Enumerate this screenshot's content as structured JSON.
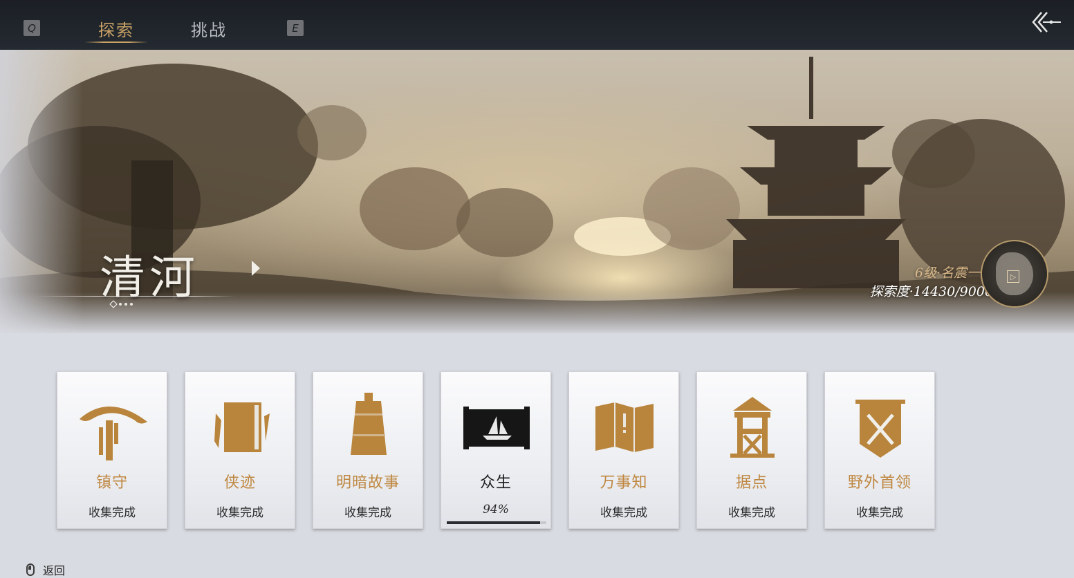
{
  "topbar": {
    "key_left": "Q",
    "key_right": "E",
    "tabs": [
      {
        "label": "探索",
        "active": true
      },
      {
        "label": "挑战",
        "active": false
      }
    ]
  },
  "region": {
    "name": "清河",
    "level_text": "6级·名震一方",
    "explore_text": "探索度·14430/9000"
  },
  "cards": [
    {
      "title": "镇守",
      "status": "收集完成",
      "icon": "straw-hat-icon"
    },
    {
      "title": "侠迹",
      "status": "收集完成",
      "icon": "book-icon"
    },
    {
      "title": "明暗故事",
      "status": "收集完成",
      "icon": "bell-icon"
    },
    {
      "title": "众生",
      "status": "94%",
      "icon": "scroll-boat-icon",
      "progress": 0.94
    },
    {
      "title": "万事知",
      "status": "收集完成",
      "icon": "folded-map-icon"
    },
    {
      "title": "据点",
      "status": "收集完成",
      "icon": "watchtower-icon"
    },
    {
      "title": "野外首领",
      "status": "收集完成",
      "icon": "crossed-swords-banner-icon"
    }
  ],
  "footer": {
    "back_label": "返回"
  },
  "colors": {
    "accent": "#c9a266",
    "card_title": "#bf8740"
  }
}
